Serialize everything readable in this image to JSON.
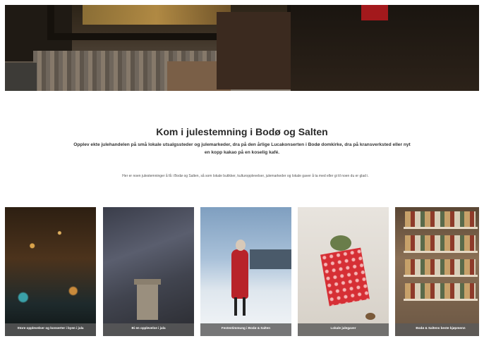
{
  "intro": {
    "headline": "Kom i julestemning i Bodø og Salten",
    "lead": "Opplev ekte julehandelen på små lokale utsalgssteder og julemarkeder, dra på den årlige Lucakonserten i Bodø domkirke, dra på kransverksted eller nyt en kopp kakao på en koselig kafé.",
    "small": "Her er noen julestemninger å få i Bodø og Salten, så som lokale butikker, kulturopplevelser, julemarkeder og lokale gaver å ta med eller gi til noen du er glad i."
  },
  "cards": [
    {
      "caption": "Store opplevelser og konserter i byen i jula"
    },
    {
      "caption": "Bi en opplevelse i jula"
    },
    {
      "caption": "Festestimmung i Bodø & Salten"
    },
    {
      "caption": "Lokale julegaver"
    },
    {
      "caption": "Bodø & Saltens beste kjøpmenn"
    }
  ]
}
